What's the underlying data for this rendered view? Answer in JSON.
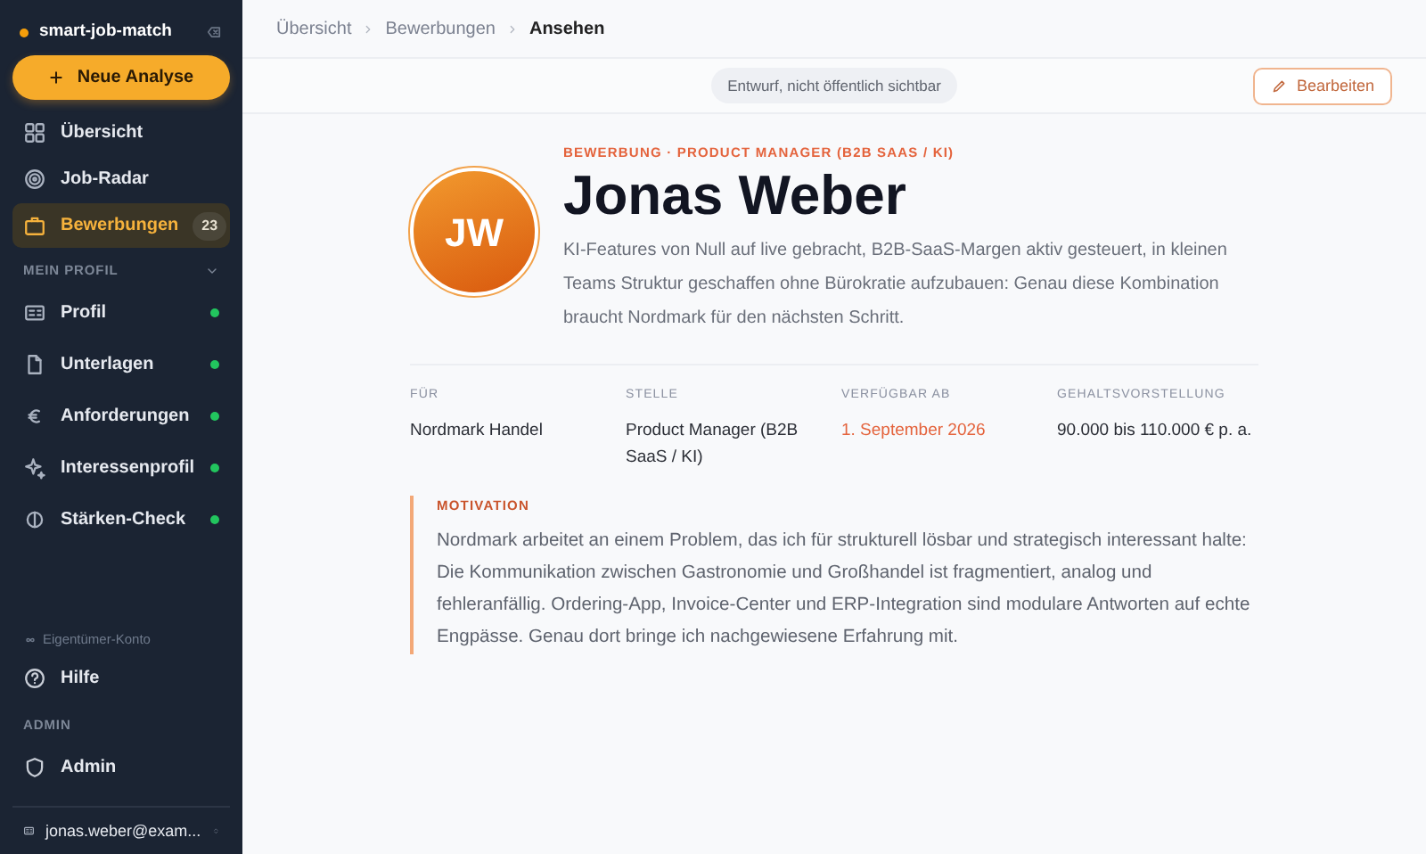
{
  "sidebar": {
    "brand": "smart-job-match",
    "new_button": "Neue Analyse",
    "nav": [
      {
        "label": "Übersicht",
        "selected": false
      },
      {
        "label": "Job-Radar",
        "selected": false
      },
      {
        "label": "Bewerbungen",
        "selected": true,
        "badge": "23"
      }
    ],
    "profile_section": {
      "title": "MEIN PROFIL",
      "expanded": true,
      "items": [
        {
          "label": "Profil",
          "done": true
        },
        {
          "label": "Unterlagen",
          "done": true
        },
        {
          "label": "Anforderungen",
          "done": true
        },
        {
          "label": "Interessenprofil",
          "done": true
        },
        {
          "label": "Stärken-Check",
          "done": true
        }
      ]
    },
    "account_note": "Eigentümer-Konto",
    "help": "Hilfe",
    "admin_section": {
      "title": "ADMIN",
      "items": [
        {
          "label": "Admin"
        }
      ]
    },
    "user": "jonas.weber@exam..."
  },
  "breadcrumbs": [
    {
      "label": "Übersicht"
    },
    {
      "label": "Bewerbungen"
    },
    {
      "label": "Ansehen"
    }
  ],
  "status_pill": "Entwurf, nicht öffentlich sichtbar",
  "edit_button": "Bearbeiten",
  "application": {
    "eyebrow": "BEWERBUNG · PRODUCT MANAGER (B2B SAAS / KI)",
    "name": "Jonas Weber",
    "initials": "JW",
    "summary": "KI-Features von Null auf live gebracht, B2B-SaaS-Margen aktiv gesteuert, in kleinen Teams Struktur geschaffen ohne Bürokratie aufzubauen: Genau diese Kombination braucht Nordmark für den nächsten Schritt.",
    "facts": [
      {
        "label": "FÜR",
        "value": "Nordmark Handel",
        "highlight": false
      },
      {
        "label": "STELLE",
        "value": "Product Manager (B2B SaaS / KI)",
        "highlight": false
      },
      {
        "label": "VERFÜGBAR AB",
        "value": "1. September 2026",
        "highlight": true
      },
      {
        "label": "GEHALTSVORSTELLUNG",
        "value": "90.000 bis 110.000 € p. a.",
        "highlight": false
      }
    ],
    "motivation": {
      "title": "MOTIVATION",
      "text": "Nordmark arbeitet an einem Problem, das ich für strukturell lösbar und strategisch interessant halte: Die Kommunikation zwischen Gastronomie und Großhandel ist fragmentiert, analog und fehleranfällig. Ordering-App, Invoice-Center und ERP-Integration sind modulare Antworten auf echte Engpässe. Genau dort bringe ich nachgewiesene Erfahrung mit."
    }
  }
}
